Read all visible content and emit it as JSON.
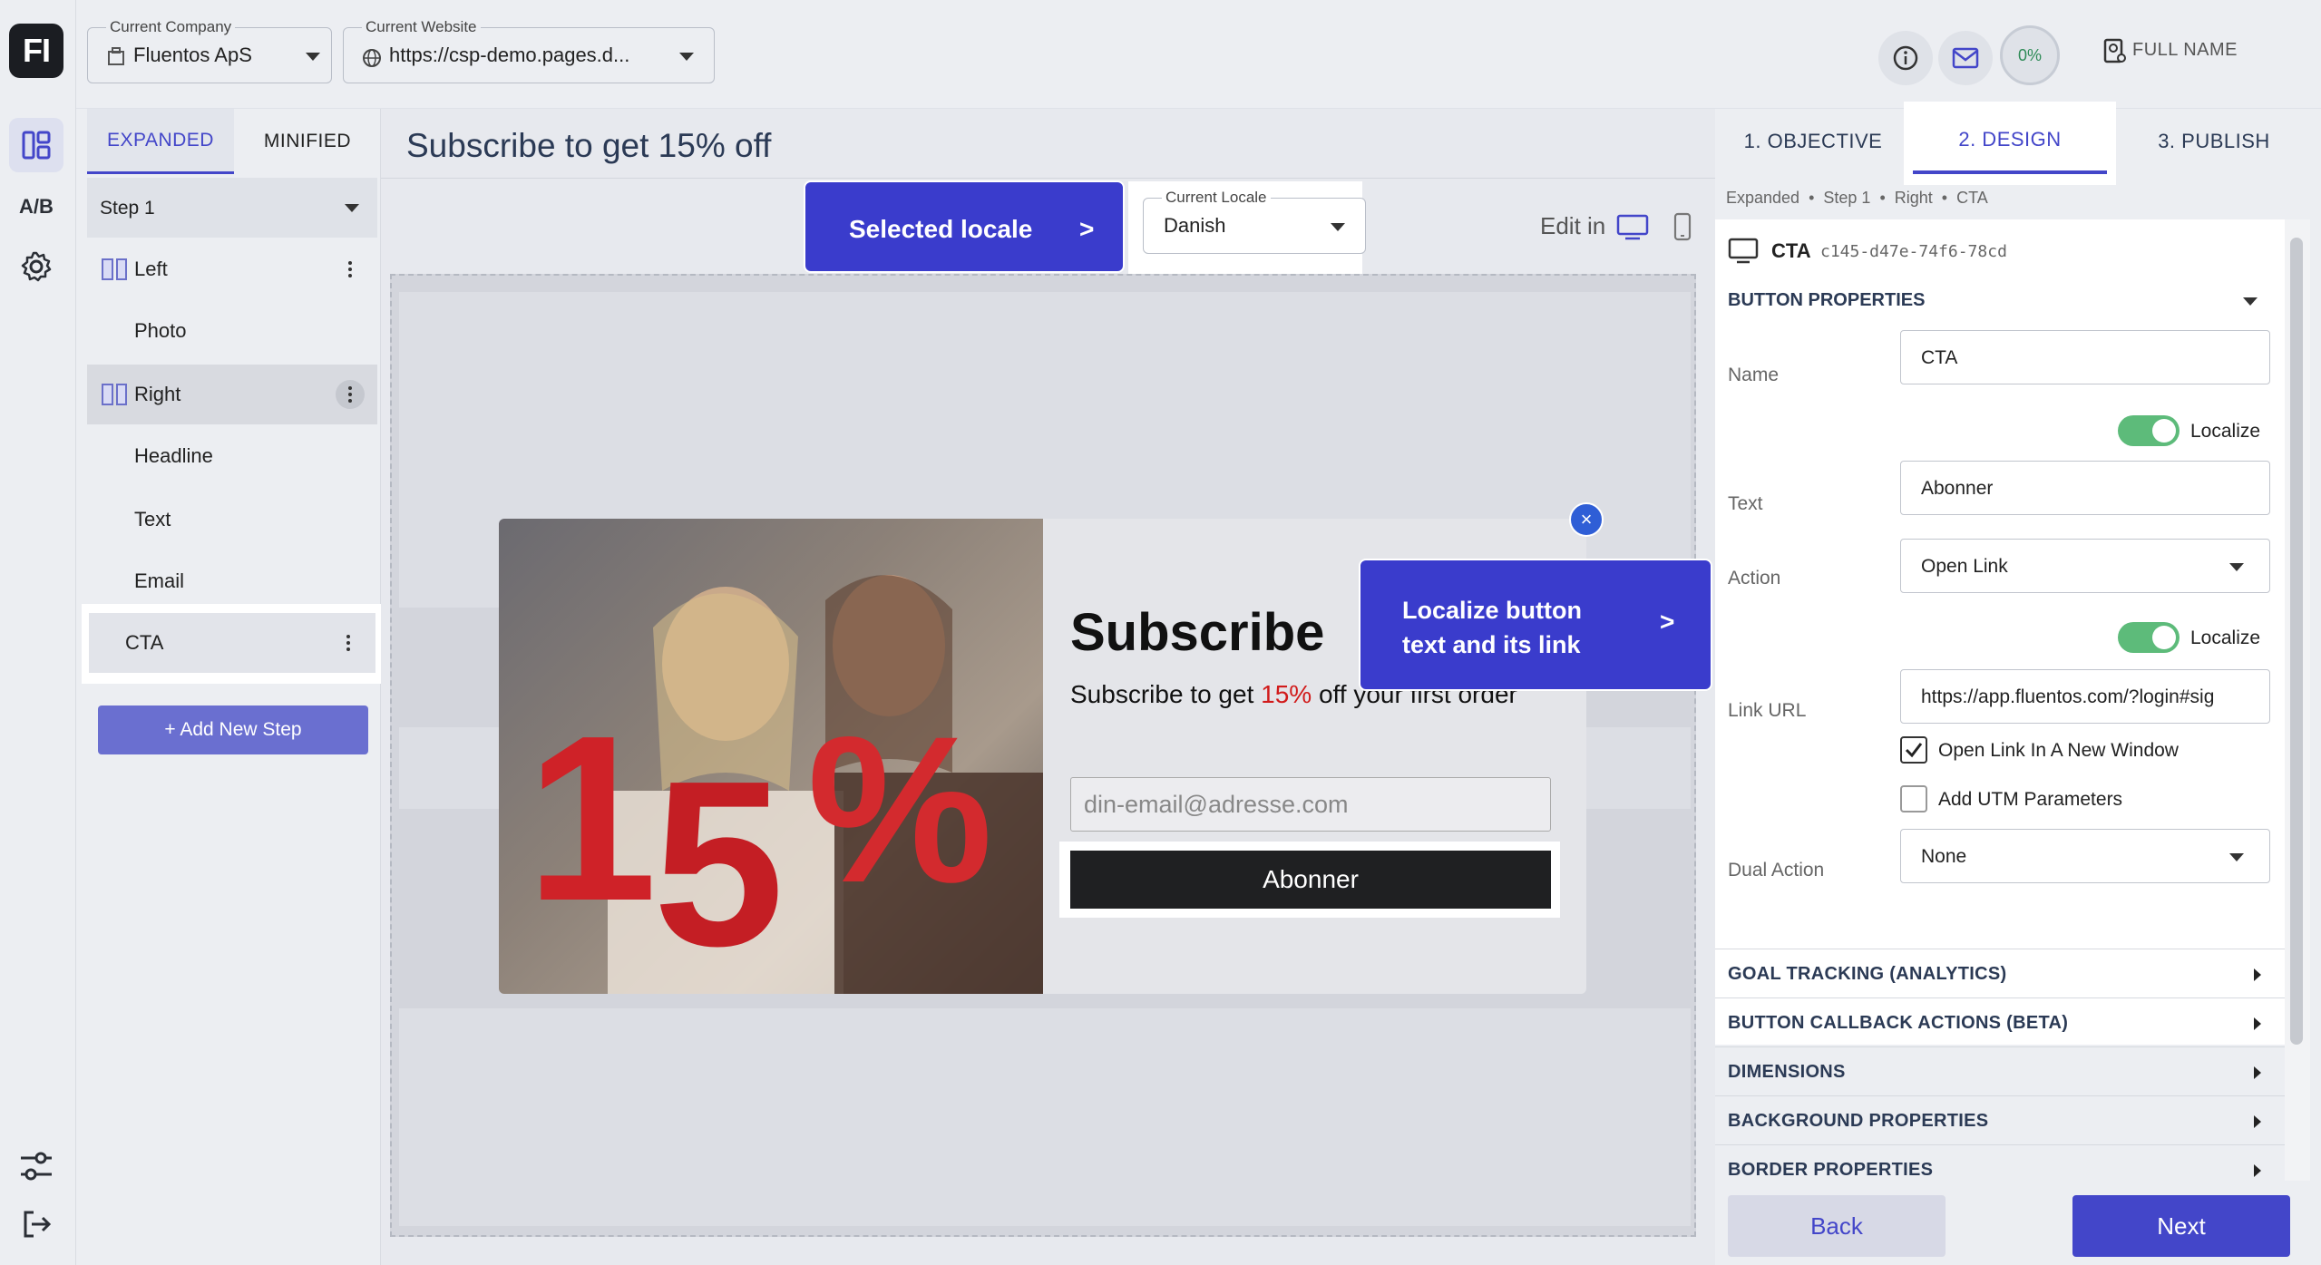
{
  "app": {
    "logo_text": "FI",
    "ab_label": "A/B"
  },
  "topbar": {
    "company_label": "Current Company",
    "company_value": "Fluentos ApS",
    "website_label": "Current Website",
    "website_value": "https://csp-demo.pages.d...",
    "progress": "0%",
    "full_name": "FULL NAME"
  },
  "layers": {
    "tabs": [
      "EXPANDED",
      "MINIFIED"
    ],
    "step": "Step 1",
    "items": [
      "Left",
      "Photo",
      "Right",
      "Headline",
      "Text",
      "Email",
      "CTA"
    ],
    "add_step": "+ Add New Step"
  },
  "center": {
    "title": "Subscribe to get 15% off",
    "locale_label": "Current Locale",
    "locale_value": "Danish",
    "edit_in": "Edit in"
  },
  "popup": {
    "title": "Subscribe",
    "subtitle_pre": "Subscribe to get ",
    "subtitle_red": "15%",
    "subtitle_post": " off your first order",
    "email_placeholder": "din-email@adresse.com",
    "cta": "Abonner",
    "photo_text": "15%"
  },
  "callouts": {
    "locale": "Selected locale",
    "locale_arrow": ">",
    "localize": "Localize button text and its link",
    "localize_line1": "Localize button",
    "localize_line2": "text and its link",
    "localize_arrow": ">"
  },
  "rpanel": {
    "tabs": [
      "1. OBJECTIVE",
      "2. DESIGN",
      "3. PUBLISH"
    ],
    "crumbs": [
      "Expanded",
      "Step 1",
      "Right",
      "CTA"
    ],
    "element_name": "CTA",
    "element_id": "c145-d47e-74f6-78cd",
    "section": "BUTTON PROPERTIES",
    "name_label": "Name",
    "name_value": "CTA",
    "localize": "Localize",
    "text_label": "Text",
    "text_value": "Abonner",
    "action_label": "Action",
    "action_value": "Open Link",
    "link_label": "Link URL",
    "link_value": "https://app.fluentos.com/?login#sig",
    "new_window": "Open Link In A New Window",
    "utm": "Add UTM Parameters",
    "dual_label": "Dual Action",
    "dual_value": "None",
    "accordions": [
      "GOAL TRACKING (ANALYTICS)",
      "BUTTON CALLBACK ACTIONS (BETA)",
      "DIMENSIONS",
      "BACKGROUND PROPERTIES",
      "BORDER PROPERTIES"
    ],
    "back": "Back",
    "next": "Next"
  },
  "colors": {
    "accent": "#4346c9",
    "callout": "#3a3ccc",
    "toggle_on": "#5dbb7a",
    "promo_red": "#d11b1b"
  }
}
